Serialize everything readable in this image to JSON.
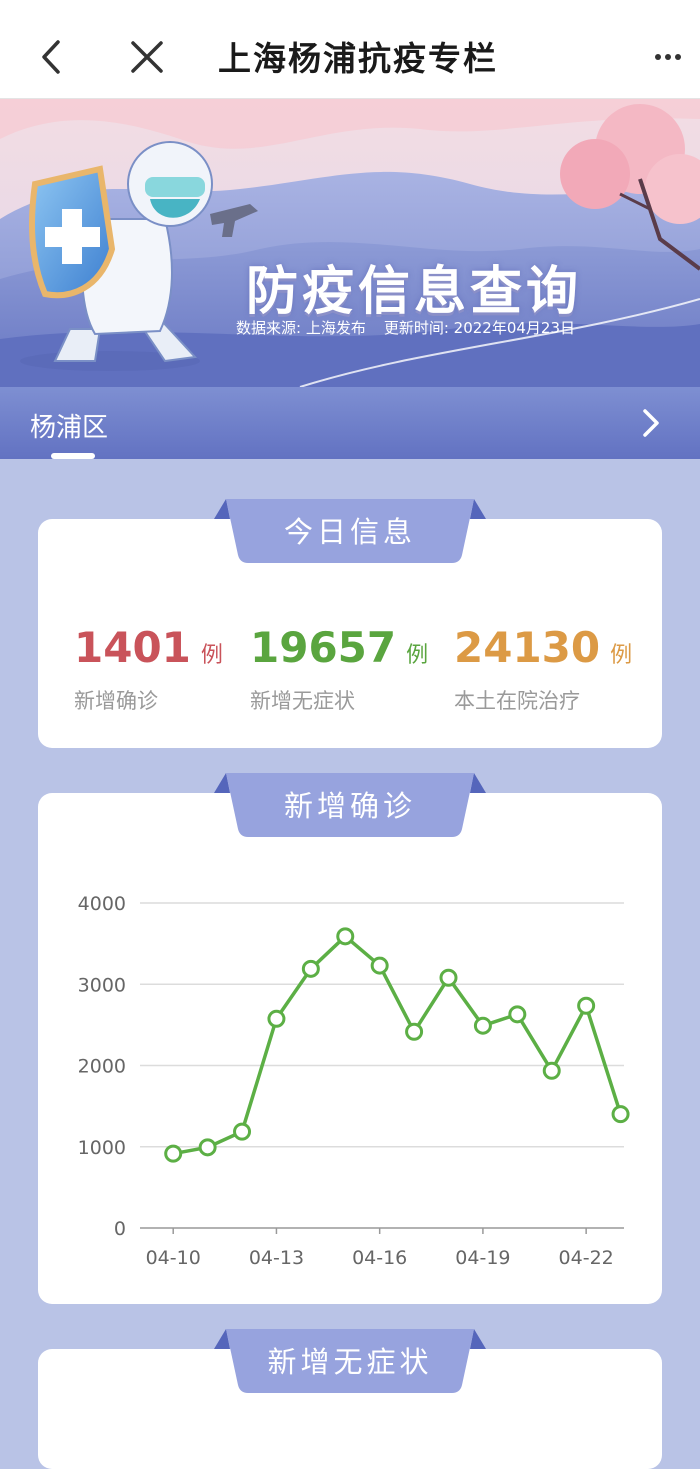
{
  "nav": {
    "title": "上海杨浦抗疫专栏",
    "back_icon": "back-arrow-icon",
    "close_icon": "close-icon",
    "more_icon": "more-icon"
  },
  "banner": {
    "title": "防疫信息查询",
    "source": "数据来源: 上海发布",
    "updated": "更新时间: 2022年04月23日"
  },
  "district": {
    "name": "杨浦区",
    "chevron_icon": "chevron-right-icon"
  },
  "today": {
    "title": "今日信息",
    "stats": [
      {
        "value": "1401",
        "unit": "例",
        "label": "新增确诊",
        "color": "#c9535a"
      },
      {
        "value": "19657",
        "unit": "例",
        "label": "新增无症状",
        "color": "#5aa53f"
      },
      {
        "value": "24130",
        "unit": "例",
        "label": "本土在院治疗",
        "color": "#dc9a45"
      }
    ]
  },
  "confirmed_card": {
    "title": "新增确诊"
  },
  "asymptomatic_card": {
    "title": "新增无症状"
  },
  "colors": {
    "tab": "#97a3de",
    "tab_dark": "#5566bb",
    "line": "#5caf45",
    "grid": "#dcdcdc",
    "axis_text": "#666666"
  },
  "chart_data": {
    "type": "line",
    "title": "新增确诊",
    "x": [
      "04-10",
      "04-11",
      "04-12",
      "04-13",
      "04-14",
      "04-15",
      "04-16",
      "04-17",
      "04-18",
      "04-19",
      "04-20",
      "04-21",
      "04-22",
      "04-23"
    ],
    "x_tick_labels": [
      "04-10",
      "04-13",
      "04-16",
      "04-19",
      "04-22"
    ],
    "series": [
      {
        "values": [
          915,
          993,
          1186,
          2576,
          3190,
          3590,
          3230,
          2415,
          3080,
          2490,
          2630,
          1935,
          2735,
          1401
        ]
      }
    ],
    "y_ticks": [
      "0",
      "1000",
      "2000",
      "3000",
      "4000"
    ],
    "ylim": [
      0,
      4000
    ],
    "grid": true,
    "legend": "none"
  }
}
